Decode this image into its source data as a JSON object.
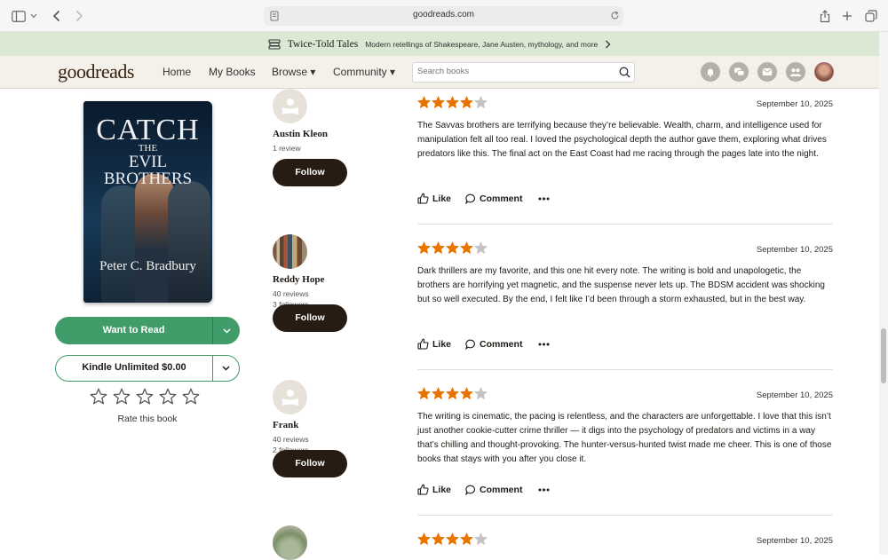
{
  "browser": {
    "url": "goodreads.com"
  },
  "promo": {
    "title": "Twice-Told Tales",
    "text": "Modern retellings of Shakespeare, Jane Austen, mythology, and more"
  },
  "nav": {
    "logo": "goodreads",
    "links": [
      "Home",
      "My Books",
      "Browse ▾",
      "Community ▾"
    ],
    "search_placeholder": "Search books"
  },
  "book": {
    "cover_title": "CATCH",
    "cover_sub_1": "THE",
    "cover_sub_2": "EVIL BROTHERS",
    "cover_author": "Peter C. Bradbury",
    "want_label": "Want to Read",
    "kindle_label": "Kindle Unlimited $0.00",
    "rate_label": "Rate this book",
    "rating_value": 0
  },
  "colors": {
    "accent_green": "#409d69",
    "star_orange": "#e87400",
    "follow_dark": "#271c14",
    "promo_bg": "#dbe8d4",
    "nav_bg": "#f4f1ea"
  },
  "reviews": [
    {
      "reviewer": "Austin Kleon",
      "stats": [
        "1 review"
      ],
      "follow": "Follow",
      "stars": 4,
      "date": "September 10, 2025",
      "text": "The Savvas brothers are terrifying because they’re believable. Wealth, charm, and intelligence used for manipulation felt all too real. I loved the psychological depth the author gave them, exploring what drives predators like this. The final act on the East Coast had me racing through the pages late into the night.",
      "like": "Like",
      "comment": "Comment"
    },
    {
      "reviewer": "Reddy Hope",
      "stats": [
        "40 reviews",
        "3 followers"
      ],
      "follow": "Follow",
      "stars": 4,
      "date": "September 10, 2025",
      "text": "Dark thrillers are my favorite, and this one hit every note. The writing is bold and unapologetic, the brothers are horrifying yet magnetic, and the suspense never lets up. The BDSM accident was shocking but so well executed. By the end, I felt like I’d been through a storm exhausted, but in the best way.",
      "like": "Like",
      "comment": "Comment"
    },
    {
      "reviewer": "Frank",
      "stats": [
        "40 reviews",
        "2 followers"
      ],
      "follow": "Follow",
      "stars": 4,
      "date": "September 10, 2025",
      "text": "The writing is cinematic, the pacing is relentless, and the characters are unforgettable. I love that this isn’t just another cookie-cutter crime thriller — it digs into the psychology of predators and victims in a way that’s chilling and thought-provoking. The hunter-versus-hunted twist made me cheer. This is one of those books that stays with you after you close it.",
      "like": "Like",
      "comment": "Comment"
    },
    {
      "stars": 4,
      "date": "September 10, 2025"
    }
  ]
}
